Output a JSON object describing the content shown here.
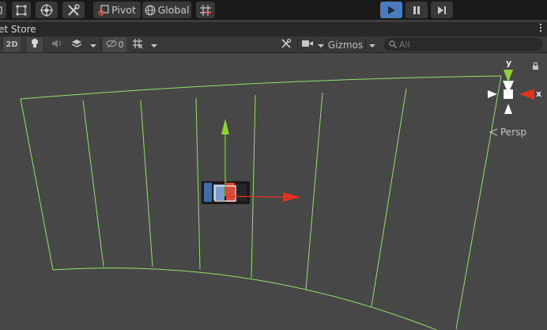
{
  "toolbar": {
    "pivot_label": "Pivot",
    "global_label": "Global"
  },
  "tab": {
    "label": "et Store"
  },
  "scene_toolbar": {
    "mode_2d_label": "2D",
    "hidden_count": "0",
    "gizmos_label": "Gizmos"
  },
  "search": {
    "placeholder": "All"
  },
  "gizmo": {
    "y_label": "y",
    "x_label": "x",
    "projection_label": "Persp"
  },
  "colors": {
    "wire": "#8fe36b",
    "x_axis": "#e0321e",
    "y_axis": "#8fd435",
    "play_active": "#4c7bbd"
  }
}
